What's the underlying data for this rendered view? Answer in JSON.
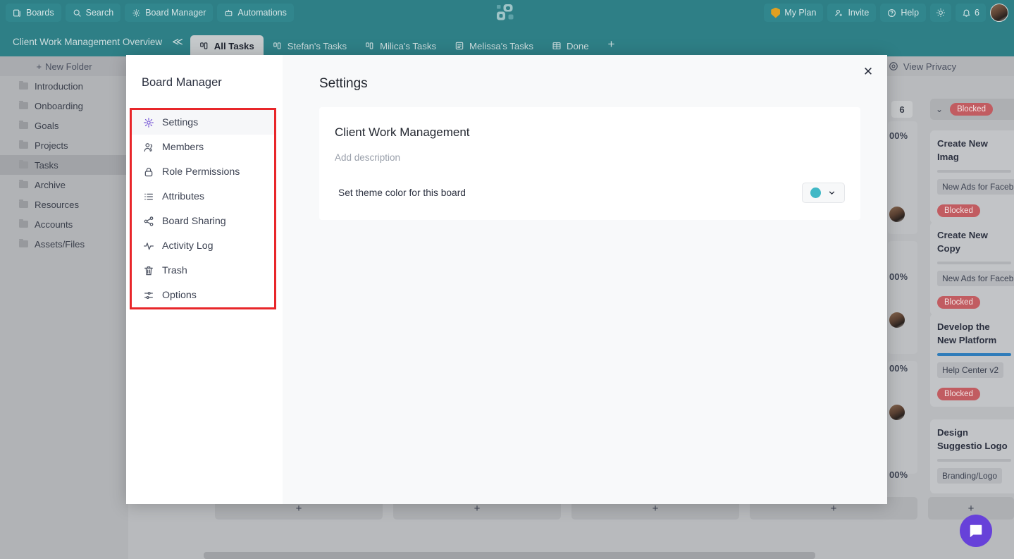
{
  "topbar": {
    "buttons": [
      {
        "label": "Boards",
        "icon": "boards-icon"
      },
      {
        "label": "Search",
        "icon": "search-icon"
      },
      {
        "label": "Board Manager",
        "icon": "gear-icon"
      },
      {
        "label": "Automations",
        "icon": "robot-icon"
      }
    ],
    "logo_alt": "app-logo",
    "my_plan": "My Plan",
    "invite": "Invite",
    "help": "Help",
    "theme_toggle_icon": "sun-icon",
    "notifications_count": "6",
    "avatar_alt": "user-avatar",
    "bg_color": "#2e7f86"
  },
  "tabbar": {
    "board_title": "Client Work Management Overview",
    "collapse_icon": "double-chevron-left-icon",
    "tabs": [
      {
        "label": "All Tasks",
        "icon": "kanban-icon",
        "active": true
      },
      {
        "label": "Stefan's Tasks",
        "icon": "kanban-icon",
        "active": false
      },
      {
        "label": "Milica's Tasks",
        "icon": "kanban-icon",
        "active": false
      },
      {
        "label": "Melissa's Tasks",
        "icon": "list-icon",
        "active": false
      },
      {
        "label": "Done",
        "icon": "table-icon",
        "active": false
      }
    ],
    "add_tab": "+"
  },
  "sidebar": {
    "new_folder": "New Folder",
    "folders": [
      {
        "label": "Introduction",
        "selected": false
      },
      {
        "label": "Onboarding",
        "selected": false
      },
      {
        "label": "Goals",
        "selected": false
      },
      {
        "label": "Projects",
        "selected": false
      },
      {
        "label": "Tasks",
        "selected": true
      },
      {
        "label": "Archive",
        "selected": false
      },
      {
        "label": "Resources",
        "selected": false
      },
      {
        "label": "Accounts",
        "selected": false
      },
      {
        "label": "Assets/Files",
        "selected": false
      }
    ]
  },
  "board": {
    "view_privacy": "View Privacy",
    "privacy_icon": "eye-icon",
    "column_count": "6",
    "column_status": "Blocked",
    "cards": [
      {
        "title": "Create New Imag",
        "tag": "New Ads for Faceb",
        "badge": "Blocked",
        "bar": "gray"
      },
      {
        "title": "Create New Copy",
        "tag": "New Ads for Faceb",
        "badge": "Blocked",
        "bar": "gray"
      },
      {
        "title": "Develop the New Platform",
        "tag": "Help Center v2",
        "badge": "Blocked",
        "bar": "blue"
      },
      {
        "title": "Design Suggestio Logo",
        "tag": "Branding/Logo",
        "badge": "",
        "bar": "gray"
      }
    ],
    "ghost_percents": [
      "00%",
      "00%",
      "00%",
      "00%"
    ],
    "add_card": "+"
  },
  "modal": {
    "title": "Board Manager",
    "close_icon": "close-icon",
    "menu": [
      {
        "label": "Settings",
        "icon": "gear-icon",
        "active": true
      },
      {
        "label": "Members",
        "icon": "members-icon",
        "active": false
      },
      {
        "label": "Role Permissions",
        "icon": "lock-icon",
        "active": false
      },
      {
        "label": "Attributes",
        "icon": "list-icon",
        "active": false
      },
      {
        "label": "Board Sharing",
        "icon": "share-icon",
        "active": false
      },
      {
        "label": "Activity Log",
        "icon": "activity-icon",
        "active": false
      },
      {
        "label": "Trash",
        "icon": "trash-icon",
        "active": false
      },
      {
        "label": "Options",
        "icon": "sliders-icon",
        "active": false
      }
    ],
    "highlight_color": "#e8262a",
    "settings": {
      "heading": "Settings",
      "board_name": "Client Work Management",
      "description_placeholder": "Add description",
      "theme_label": "Set theme color for this board",
      "theme_color": "#41b8c6",
      "theme_chevron_icon": "chevron-down-icon"
    }
  },
  "intercom": {
    "icon": "messenger-icon",
    "color": "#6741d9"
  }
}
